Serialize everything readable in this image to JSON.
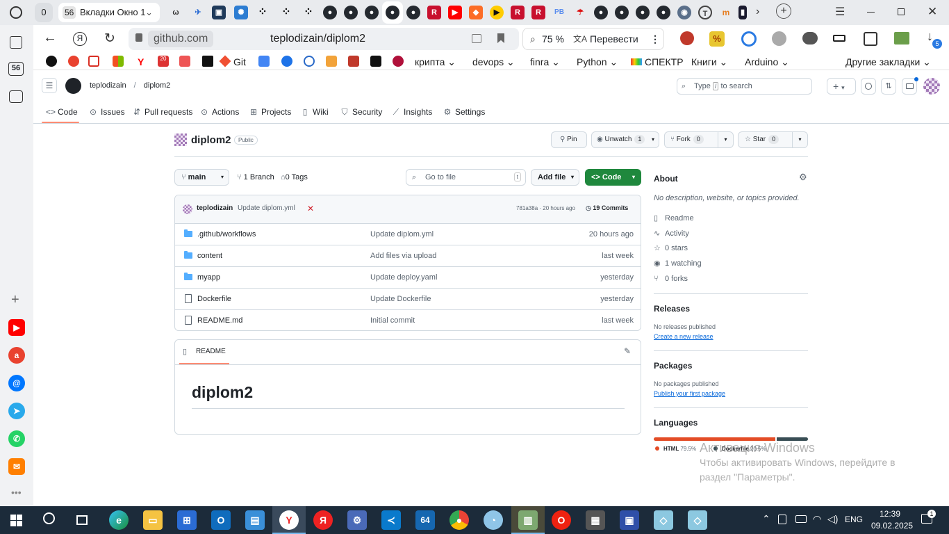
{
  "tabs": {
    "group_count": "0",
    "active_count": "56",
    "active_label": "Вкладки Окно 1"
  },
  "address": {
    "domain": "github.com",
    "title": "teplodizain/diplom2",
    "zoom": "75 %",
    "translate": "Перевести",
    "downloads_badge": "5"
  },
  "bookmarks": {
    "items": [
      "Git",
      "крипта",
      "devops",
      "finra",
      "Python",
      "СПЕКТР",
      "Книги",
      "Arduino"
    ],
    "other": "Другие закладки"
  },
  "left_counter": "56",
  "github": {
    "owner": "teplodizain",
    "repo": "diplom2",
    "search_placeholder_pre": "Type",
    "search_key": "/",
    "search_placeholder_post": "to search",
    "nav": [
      "Code",
      "Issues",
      "Pull requests",
      "Actions",
      "Projects",
      "Wiki",
      "Security",
      "Insights",
      "Settings"
    ],
    "visibility": "Public",
    "pin": "Pin",
    "unwatch": "Unwatch",
    "unwatch_count": "1",
    "fork": "Fork",
    "fork_count": "0",
    "star": "Star",
    "star_count": "0",
    "branch": "main",
    "branches": "1 Branch",
    "tags": "0 Tags",
    "goto_placeholder": "Go to file",
    "goto_key": "t",
    "add_file": "Add file",
    "code_btn": "Code",
    "commit": {
      "author": "teplodizain",
      "message": "Update diplom.yml",
      "hash_time": "781a38a · 20 hours ago",
      "commits": "19 Commits"
    },
    "files": [
      {
        "name": ".github/workflows",
        "msg": "Update diplom.yml",
        "time": "20 hours ago",
        "type": "dir"
      },
      {
        "name": "content",
        "msg": "Add files via upload",
        "time": "last week",
        "type": "dir"
      },
      {
        "name": "myapp",
        "msg": "Update deploy.yaml",
        "time": "yesterday",
        "type": "dir"
      },
      {
        "name": "Dockerfile",
        "msg": "Update Dockerfile",
        "time": "yesterday",
        "type": "file"
      },
      {
        "name": "README.md",
        "msg": "Initial commit",
        "time": "last week",
        "type": "file"
      }
    ],
    "readme_tab": "README",
    "readme_title": "diplom2",
    "about": {
      "title": "About",
      "desc": "No description, website, or topics provided.",
      "items": [
        "Readme",
        "Activity",
        "0 stars",
        "1 watching",
        "0 forks"
      ]
    },
    "releases": {
      "title": "Releases",
      "none": "No releases published",
      "link": "Create a new release"
    },
    "packages": {
      "title": "Packages",
      "none": "No packages published",
      "link": "Publish your first package"
    },
    "languages": {
      "title": "Languages",
      "items": [
        {
          "name": "HTML",
          "pct": "79.5%",
          "color": "#e34c26",
          "value": 79.5
        },
        {
          "name": "Dockerfile",
          "pct": "20.5%",
          "color": "#384d54",
          "value": 20.5
        }
      ]
    }
  },
  "watermark": {
    "line1": "Активация Windows",
    "line2": "Чтобы активировать Windows, перейдите в",
    "line3": "раздел \"Параметры\"."
  },
  "taskbar": {
    "time": "12:39",
    "date": "09.02.2025",
    "lang": "ENG",
    "notif": "1"
  }
}
